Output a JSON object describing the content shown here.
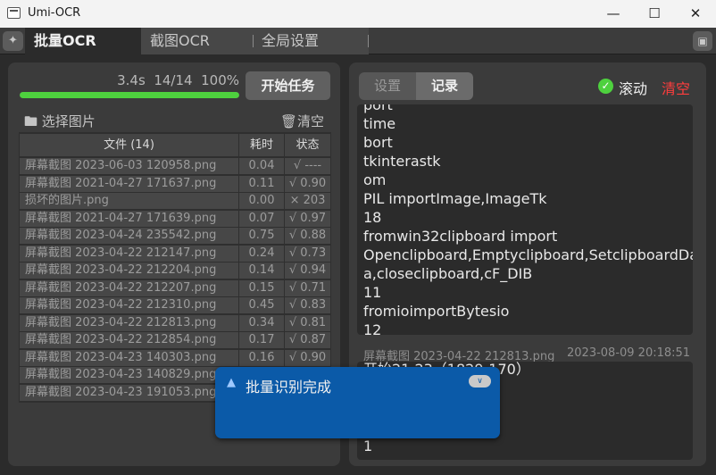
{
  "window": {
    "title": "Umi-OCR",
    "minimize_icon": "minimize-icon",
    "maximize_icon": "maximize-icon",
    "close_icon": "close-icon"
  },
  "tabs": [
    {
      "label": "批量OCR",
      "active": true
    },
    {
      "label": "截图OCR",
      "active": false
    },
    {
      "label": "全局设置",
      "active": false
    }
  ],
  "left": {
    "timer": "3.4s",
    "count": "14/14",
    "percent": "100%",
    "progress_fraction": 1.0,
    "start_label": "开始任务",
    "select_label": "选择图片",
    "clear_label": "清空",
    "table": {
      "headers": {
        "file": "文件 (14)",
        "time": "耗时",
        "state": "状态"
      },
      "rows": [
        {
          "file": "屏幕截图 2023-06-03 120958.png",
          "time": "0.04",
          "state": "√ ----"
        },
        {
          "file": "屏幕截图 2021-04-27 171637.png",
          "time": "0.11",
          "state": "√ 0.90"
        },
        {
          "file": "损坏的图片.png",
          "time": "0.00",
          "state": "× 203"
        },
        {
          "file": "屏幕截图 2021-04-27 171639.png",
          "time": "0.07",
          "state": "√ 0.97"
        },
        {
          "file": "屏幕截图 2023-04-24 235542.png",
          "time": "0.75",
          "state": "√ 0.88"
        },
        {
          "file": "屏幕截图 2023-04-22 212147.png",
          "time": "0.24",
          "state": "√ 0.73"
        },
        {
          "file": "屏幕截图 2023-04-22 212204.png",
          "time": "0.14",
          "state": "√ 0.94"
        },
        {
          "file": "屏幕截图 2023-04-22 212207.png",
          "time": "0.15",
          "state": "√ 0.71"
        },
        {
          "file": "屏幕截图 2023-04-22 212310.png",
          "time": "0.45",
          "state": "√ 0.83"
        },
        {
          "file": "屏幕截图 2023-04-22 212813.png",
          "time": "0.34",
          "state": "√ 0.81"
        },
        {
          "file": "屏幕截图 2023-04-22 212854.png",
          "time": "0.17",
          "state": "√ 0.87"
        },
        {
          "file": "屏幕截图 2023-04-23 140303.png",
          "time": "0.16",
          "state": "√ 0.90"
        },
        {
          "file": "屏幕截图 2023-04-23 140829.png",
          "time": "",
          "state": ""
        },
        {
          "file": "屏幕截图 2023-04-23 191053.png",
          "time": "",
          "state": ""
        }
      ]
    }
  },
  "right": {
    "seg_settings": "设置",
    "seg_history": "记录",
    "scroll_label": "滚动",
    "clear_label": "清空",
    "result_lines": [
      "port",
      "time",
      "bort",
      "tkinterastk",
      "om",
      "PIL importImage,ImageTk",
      "18",
      "fromwin32clipboard import",
      "Openclipboard,Emptyclipboard,SetclipboardDat",
      "a,closeclipboard,cF_DIB",
      "11",
      "fromioimportBytesio",
      "12"
    ],
    "record_file": "屏幕截图 2023-04-22 212813.png",
    "record_time": "2023-08-09 20:18:51",
    "result2_lines": [
      "开始21.23（1829-170）",
      "1"
    ]
  },
  "toast": {
    "title": "批量识别完成",
    "icon": "bell-icon"
  },
  "colors": {
    "accent": "#4ed13e",
    "toast": "#0b5aa8",
    "danger": "#ff3d3d"
  }
}
